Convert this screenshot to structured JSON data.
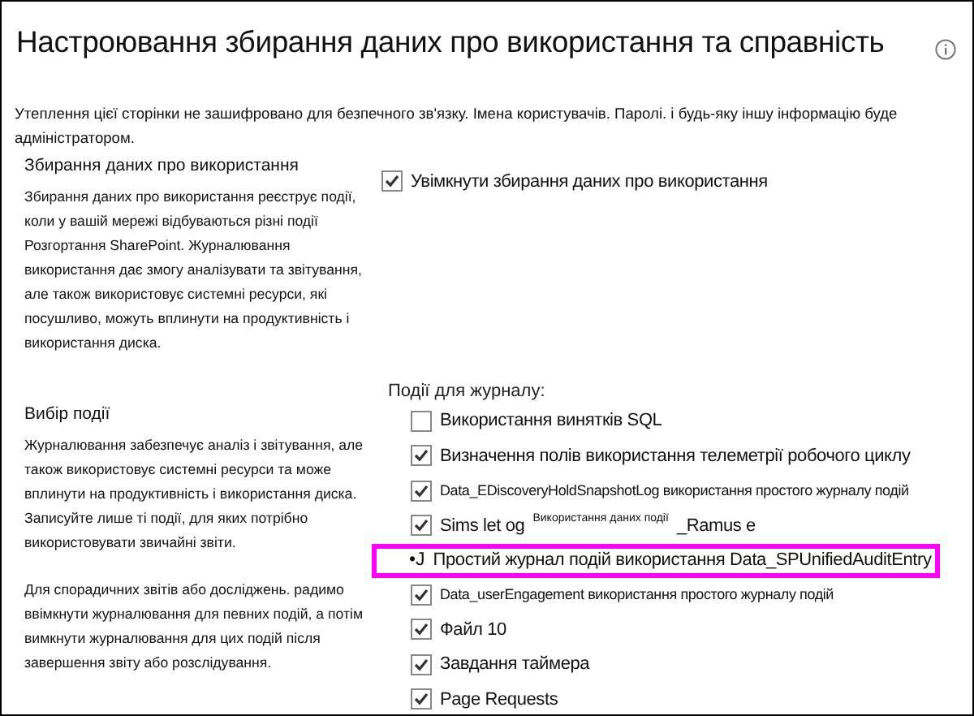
{
  "title": "Настроювання збирання даних про використання та справність",
  "warning": "Утеплення цієї сторінки не зашифровано для безпечного зв'язку. Імена користувачів. Паролі. і будь-яку іншу інформацію буде адміністратором.",
  "usage_section": {
    "heading": "Збирання даних про використання",
    "description": "Збирання даних про використання реєструє події, коли у вашій мережі відбуваються різні події Розгортання SharePoint. Журналювання використання дає змогу аналізувати та звітування, але також використовує системні ресурси, які посушливо, можуть вплинути на продуктивність і використання диска.",
    "enable": {
      "label": "Увімкнути збирання даних про використання",
      "checked": true
    }
  },
  "events_section": {
    "heading": "Вибір події",
    "description": "Журналювання забезпечує аналіз і звітування, але також використовує системні ресурси та може вплинути на продуктивність і використання диска. Записуйте лише ті події, для яких потрібно використовувати звичайні звіти.",
    "note": "Для спорадичних звітів або досліджень. радимо ввімкнути журналювання для певних подій, а потім вимкнути журналювання для цих подій після завершення звіту або розслідування.",
    "list_label": "Події для журналу:",
    "events": [
      {
        "kind": "checkbox",
        "label": "Використання винятків SQL",
        "checked": false,
        "compact": false
      },
      {
        "kind": "checkbox",
        "label": "Визначення полів використання телеметрії робочого циклу",
        "checked": true,
        "compact": false
      },
      {
        "kind": "checkbox",
        "label": "Data_EDiscoveryHoldSnapshotLog використання простого журналу подій",
        "checked": true,
        "compact": true
      },
      {
        "kind": "garbled",
        "label": "Sims let og",
        "overlay": "Використання даних події",
        "suffix": "_Ramus e",
        "checked": true,
        "compact": false
      },
      {
        "kind": "bullet",
        "marker": "•J",
        "label": "Простий журнал подій використання Data_SPUnifiedAuditEntry",
        "highlighted": true,
        "compact": false
      },
      {
        "kind": "checkbox",
        "label": "Data_userEngagement використання простого журналу подій",
        "checked": true,
        "compact": true
      },
      {
        "kind": "checkbox",
        "label": "Файл 10",
        "checked": true,
        "compact": false
      },
      {
        "kind": "checkbox",
        "label": "Завдання таймера",
        "checked": true,
        "compact": false
      },
      {
        "kind": "checkbox",
        "label": "Page Requests",
        "checked": true,
        "compact": false
      }
    ]
  }
}
